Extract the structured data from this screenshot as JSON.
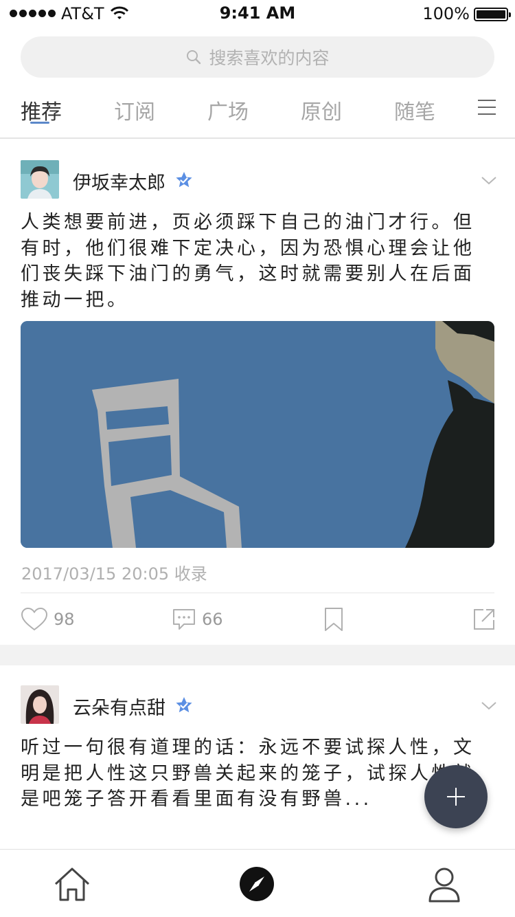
{
  "status_bar": {
    "carrier": "AT&T",
    "time": "9:41 AM",
    "battery": "100%"
  },
  "search": {
    "placeholder": "搜索喜欢的内容",
    "icon": "search-icon"
  },
  "tabs": [
    {
      "label": "推荐",
      "active": true
    },
    {
      "label": "订阅"
    },
    {
      "label": "广场"
    },
    {
      "label": "原创"
    },
    {
      "label": "随笔"
    }
  ],
  "posts": [
    {
      "author": "伊坂幸太郎",
      "verified": true,
      "text": "人类想要前进，页必须踩下自己的油门才行。但有时，他们很难下定决心，因为恐惧心理会让他们丧失踩下油门的勇气，这时就需要别人在后面推动一把。",
      "meta": "2017/03/15 20:05 收录",
      "likes": "98",
      "comments": "66"
    },
    {
      "author": "云朵有点甜",
      "verified": true,
      "text": "听过一句很有道理的话：永远不要试探人性，文明是把人性这只野兽关起来的笼子，试探人性就是吧笼子答开看看里面有没有野兽..."
    }
  ],
  "colors": {
    "accent": "#5b88c9",
    "fab": "#3c4353",
    "verified": "#5b8fe3"
  },
  "bottom_nav": [
    {
      "icon": "home-icon"
    },
    {
      "icon": "compass-icon"
    },
    {
      "icon": "user-icon"
    }
  ]
}
